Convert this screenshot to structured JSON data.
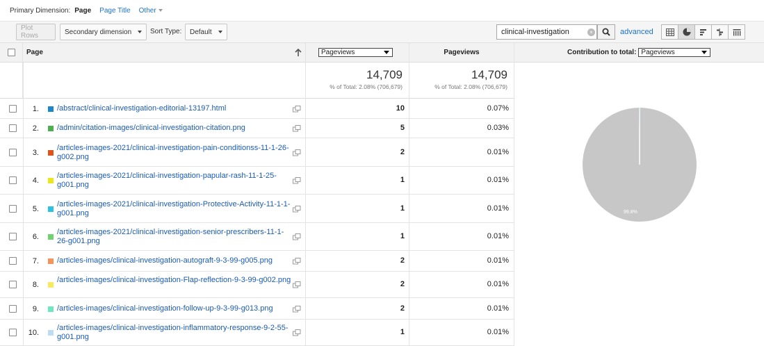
{
  "primary_dimension": {
    "label": "Primary Dimension:",
    "active": "Page",
    "options": [
      "Page Title",
      "Other"
    ]
  },
  "toolbar": {
    "plot_rows": "Plot Rows",
    "secondary_dimension": "Secondary dimension",
    "sort_type_label": "Sort Type:",
    "sort_type_value": "Default",
    "search_value": "clinical-investigation",
    "advanced": "advanced",
    "view_icons": [
      "table-view-icon",
      "pie-view-icon",
      "performance-view-icon",
      "comparison-view-icon",
      "term-cloud-view-icon"
    ]
  },
  "columns": {
    "page": "Page",
    "metric_select": "Pageviews",
    "pageviews": "Pageviews",
    "contribution_label": "Contribution to total:",
    "contribution_select": "Pageviews"
  },
  "totals": {
    "col1_value": "14,709",
    "col1_sub": "% of Total: 2.08% (706,679)",
    "col2_value": "14,709",
    "col2_sub": "% of Total: 2.08% (706,679)"
  },
  "rows": [
    {
      "num": "1.",
      "color": "#1a88c9",
      "url": "/abstract/clinical-investigation-editorial-13197.html",
      "pageviews": "10",
      "pct": "0.07%"
    },
    {
      "num": "2.",
      "color": "#4caf50",
      "url": "/admin/citation-images/clinical-investigation-citation.png",
      "pageviews": "5",
      "pct": "0.03%"
    },
    {
      "num": "3.",
      "color": "#e0531b",
      "url": "/articles-images-2021/clinical-investigation-pain-conditionss-11-1-26-g002.png",
      "pageviews": "2",
      "pct": "0.01%"
    },
    {
      "num": "4.",
      "color": "#e8e81a",
      "url": "/articles-images-2021/clinical-investigation-papular-rash-11-1-25-g001.png",
      "pageviews": "1",
      "pct": "0.01%"
    },
    {
      "num": "5.",
      "color": "#2bc3e3",
      "url": "/articles-images-2021/clinical-investigation-Protective-Activity-11-1-1-g001.png",
      "pageviews": "1",
      "pct": "0.01%"
    },
    {
      "num": "6.",
      "color": "#6fd36f",
      "url": "/articles-images-2021/clinical-investigation-senior-prescribers-11-1-26-g001.png",
      "pageviews": "1",
      "pct": "0.01%"
    },
    {
      "num": "7.",
      "color": "#f5935b",
      "url": "/articles-images/clinical-investigation-autograft-9-3-99-g005.png",
      "pageviews": "2",
      "pct": "0.01%"
    },
    {
      "num": "8.",
      "color": "#f7ea5e",
      "url": "/articles-images/clinical-investigation-Flap-reflection-9-3-99-g002.png",
      "pageviews": "2",
      "pct": "0.01%"
    },
    {
      "num": "9.",
      "color": "#6ee8c0",
      "url": "/articles-images/clinical-investigation-follow-up-9-3-99-g013.png",
      "pageviews": "2",
      "pct": "0.01%"
    },
    {
      "num": "10.",
      "color": "#bcdcf5",
      "url": "/articles-images/clinical-investigation-inflammatory-response-9-2-55-g001.png",
      "pageviews": "1",
      "pct": "0.01%"
    }
  ],
  "chart_data": {
    "type": "pie",
    "slices": [
      {
        "value": 99.8,
        "color": "#c7c7c7",
        "label": "99.8%"
      },
      {
        "value": 0.07,
        "color": "#1a88c9"
      },
      {
        "value": 0.03,
        "color": "#4caf50"
      },
      {
        "value": 0.1,
        "color": "#c7c7c7"
      }
    ],
    "colors": {
      "background": "#c7c7c7",
      "separator": "#ffffff"
    }
  }
}
